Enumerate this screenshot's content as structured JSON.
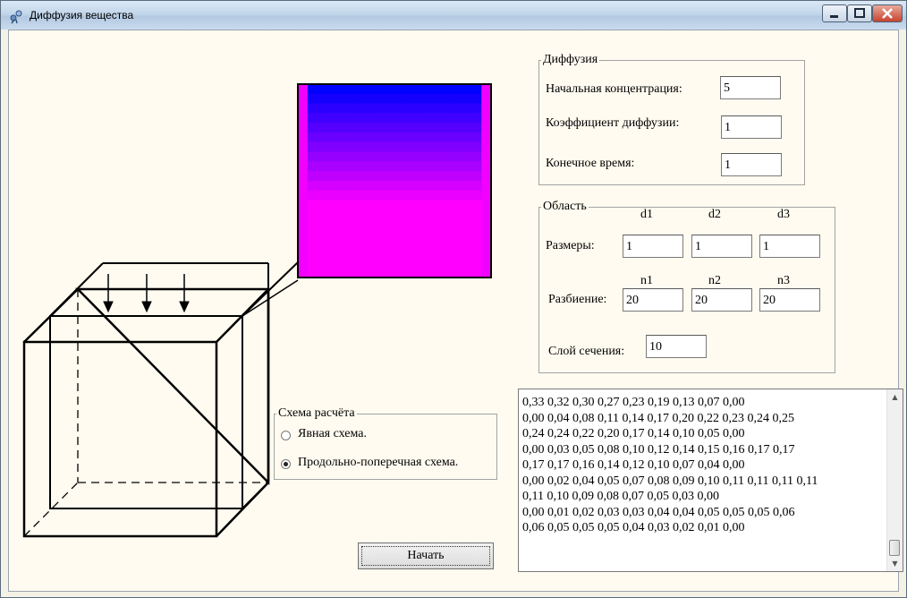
{
  "window": {
    "title": "Диффузия вещества"
  },
  "diffusion": {
    "legend": "Диффузия",
    "initial_concentration_label": "Начальная концентрация:",
    "initial_concentration": "5",
    "diffusion_coefficient_label": "Коэффициент диффузии:",
    "diffusion_coefficient": "1",
    "end_time_label": "Конечное время:",
    "end_time": "1"
  },
  "region": {
    "legend": "Область",
    "sizes_label": "Размеры:",
    "size_headers": [
      "d1",
      "d2",
      "d3"
    ],
    "sizes": [
      "1",
      "1",
      "1"
    ],
    "partition_label": "Разбиение:",
    "partition_headers": [
      "n1",
      "n2",
      "n3"
    ],
    "partition": [
      "20",
      "20",
      "20"
    ],
    "section_layer_label": "Слой сечения:",
    "section_layer": "10"
  },
  "scheme": {
    "legend": "Схема расчёта",
    "options": [
      "Явная схема.",
      "Продольно-поперечная схема."
    ],
    "selected_index": 1
  },
  "start_button": "Начать",
  "output_lines": [
    "0,33 0,32 0,30 0,27 0,23 0,19 0,13 0,07 0,00",
    "0,00 0,04 0,08 0,11 0,14 0,17 0,20 0,22 0,23 0,24 0,25",
    "0,24 0,24 0,22 0,20 0,17 0,14 0,10 0,05 0,00",
    "0,00 0,03 0,05 0,08 0,10 0,12 0,14 0,15 0,16 0,17 0,17",
    "0,17 0,17 0,16 0,14 0,12 0,10 0,07 0,04 0,00",
    "0,00 0,02 0,04 0,05 0,07 0,08 0,09 0,10 0,11 0,11 0,11 0,11",
    "0,11 0,10 0,09 0,08 0,07 0,05 0,03 0,00",
    "0,00 0,01 0,02 0,03 0,03 0,04 0,04 0,05 0,05 0,05 0,06",
    "0,06 0,05 0,05 0,05 0,04 0,03 0,02 0,01 0,00"
  ],
  "colors": {
    "low": "#ff00ff",
    "high": "#0000ff",
    "frame": "#000000"
  }
}
